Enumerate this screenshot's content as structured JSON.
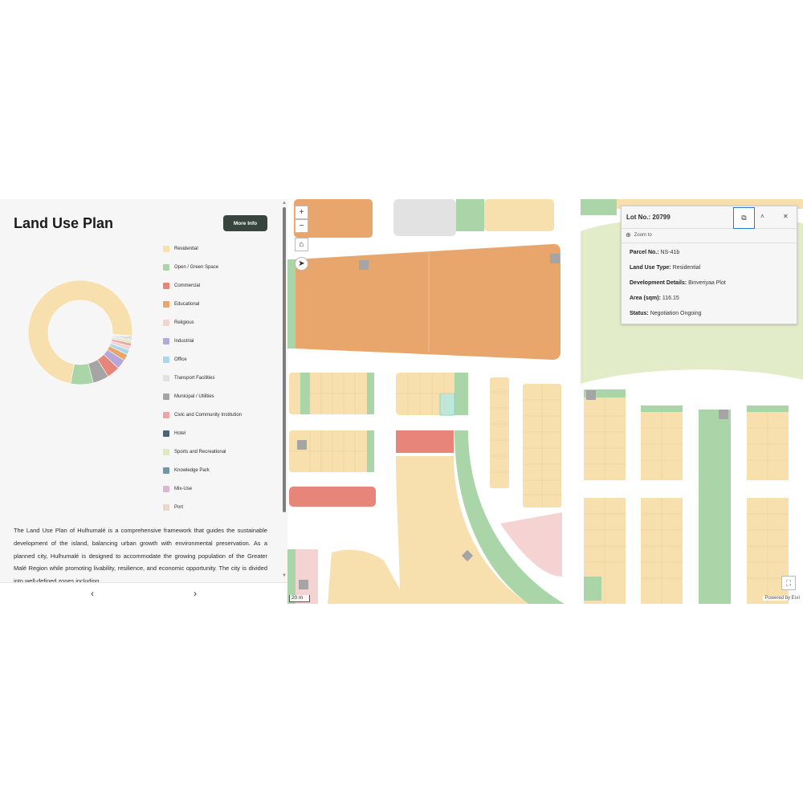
{
  "panel": {
    "title": "Land Use Plan",
    "more_info_label": "More Info",
    "description": "The Land Use Plan of Hulhumalé is a comprehensive framework that guides the sustainable development of the island, balancing urban growth with environmental preservation. As a planned city, Hulhumalé is designed to accommodate the growing population of the Greater Malé Region while promoting livability, resilience, and economic opportunity. The city is divided into well-defined zones including",
    "prev_icon": "chevron-left-icon",
    "next_icon": "chevron-right-icon",
    "prev_label": "‹",
    "next_label": "›",
    "legend": [
      {
        "label": "Residential",
        "color": "#f7dfae"
      },
      {
        "label": "Open / Green Space",
        "color": "#a9d5a8"
      },
      {
        "label": "Commercial",
        "color": "#e8857a"
      },
      {
        "label": "Educational",
        "color": "#e8a56c"
      },
      {
        "label": "Religious",
        "color": "#f5d3d3"
      },
      {
        "label": "Industrial",
        "color": "#b5a7d6"
      },
      {
        "label": "Office",
        "color": "#a9d8ea"
      },
      {
        "label": "Transport Facilities",
        "color": "#e2e2e2"
      },
      {
        "label": "Municipal / Utilities",
        "color": "#a5a5a5"
      },
      {
        "label": "Civic and Community Institution",
        "color": "#eaa6a6"
      },
      {
        "label": "Hotel",
        "color": "#4e6278"
      },
      {
        "label": "Sports and Recreational",
        "color": "#dce8bd"
      },
      {
        "label": "Knowledge Park",
        "color": "#6f98a6"
      },
      {
        "label": "Mix-Use",
        "color": "#dcb6cf"
      },
      {
        "label": "Port",
        "color": "#ead6cb"
      }
    ]
  },
  "chart_data": {
    "type": "pie",
    "categories": [
      "Residential",
      "Open / Green Space",
      "Municipal / Utilities",
      "Commercial",
      "Industrial",
      "Educational",
      "Office",
      "Religious",
      "Civic and Community Institution",
      "Sports and Recreational",
      "Transport Facilities",
      "Knowledge Park",
      "Mix-Use",
      "Hotel",
      "Port"
    ],
    "values": [
      73,
      7,
      5,
      4,
      3,
      2,
      1.5,
      1.2,
      1,
      0.8,
      0.6,
      0.3,
      0.3,
      0.2,
      0.1
    ]
  },
  "map": {
    "zoom_in_label": "+",
    "zoom_out_label": "−",
    "home_icon": "home-icon",
    "compass_icon": "compass-icon",
    "fullscreen_icon": "fullscreen-icon",
    "scale_label": "20 m",
    "attribution": "Powered by Esri"
  },
  "popup": {
    "title": "Lot No.: 20799",
    "zoom_to_label": "Zoom to",
    "dock_icon": "dock-icon",
    "collapse_icon": "chevron-up-icon",
    "close_icon": "close-icon",
    "dock_label": "⧉",
    "collapse_label": "˄",
    "close_label": "✕",
    "attributes": [
      {
        "key": "Parcel No.:",
        "value": "NS-41b"
      },
      {
        "key": "Land Use Type:",
        "value": "Residential"
      },
      {
        "key": "Development Details:",
        "value": "Binveriyaa Plot"
      },
      {
        "key": "Area (sqm):",
        "value": "116.15"
      },
      {
        "key": "Status:",
        "value": "Negotiation Ongoing"
      }
    ]
  }
}
